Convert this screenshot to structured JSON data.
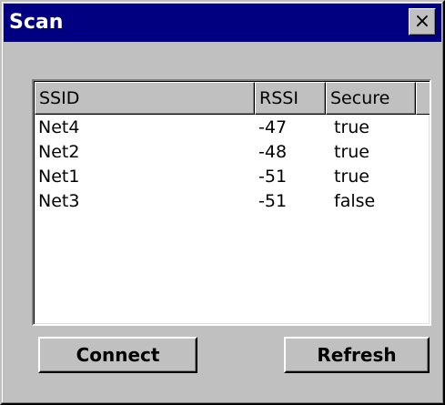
{
  "window": {
    "title": "Scan",
    "close_glyph": "×"
  },
  "table": {
    "columns": [
      "SSID",
      "RSSI",
      "Secure"
    ],
    "rows": [
      {
        "ssid": "Net4",
        "rssi": "-47",
        "secure": "true"
      },
      {
        "ssid": "Net2",
        "rssi": "-48",
        "secure": "true"
      },
      {
        "ssid": "Net1",
        "rssi": "-51",
        "secure": "true"
      },
      {
        "ssid": "Net3",
        "rssi": "-51",
        "secure": "false"
      }
    ]
  },
  "buttons": {
    "connect_label": "Connect",
    "refresh_label": "Refresh"
  },
  "colors": {
    "titlebar": "#000080",
    "face": "#c0c0c0",
    "list_bg": "#ffffff"
  }
}
